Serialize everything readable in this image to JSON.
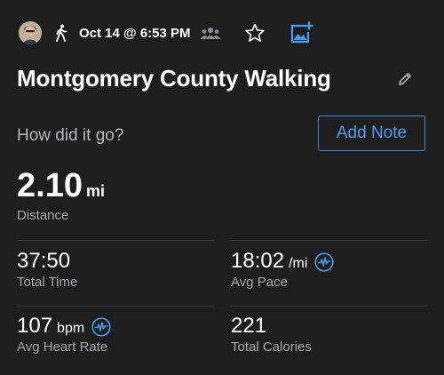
{
  "header": {
    "date": "Oct 14 @ 6:53 PM",
    "icons": [
      "avatar",
      "walking-icon",
      "people-icon",
      "star-icon",
      "add-photo-icon"
    ]
  },
  "activity": {
    "title": "Montgomery County Walking"
  },
  "feedback": {
    "question": "How did it go?",
    "add_note_label": "Add Note"
  },
  "distance": {
    "value": "2.10",
    "unit": "mi",
    "label": "Distance"
  },
  "stats": {
    "total_time": {
      "value": "37:50",
      "label": "Total Time"
    },
    "avg_pace": {
      "value": "18:02",
      "unit": "/mi",
      "label": "Avg Pace"
    },
    "avg_heart_rate": {
      "value": "107",
      "unit": "bpm",
      "label": "Avg Heart Rate"
    },
    "total_calories": {
      "value": "221",
      "label": "Total Calories"
    }
  },
  "colors": {
    "background": "#1e1e1f",
    "accent": "#4a9cf0",
    "secondary_text": "#a8a8aa"
  }
}
